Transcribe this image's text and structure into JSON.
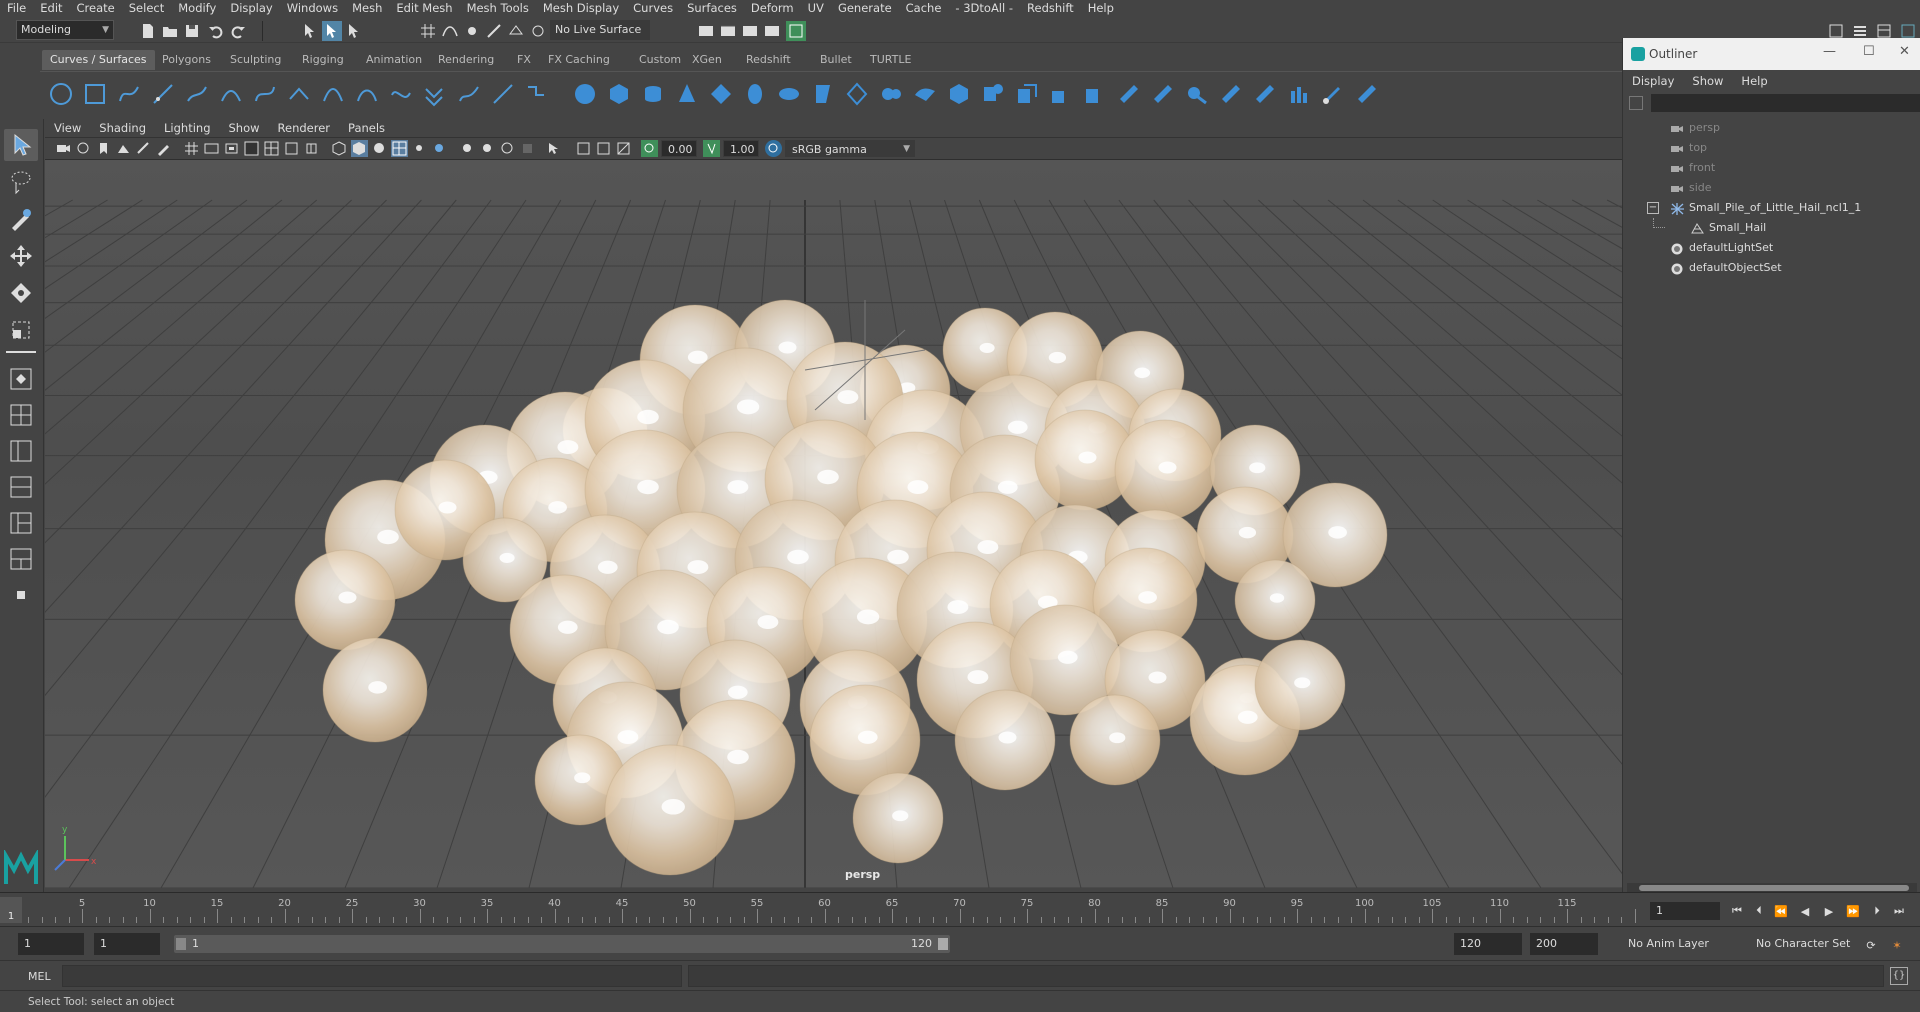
{
  "menubar": {
    "items": [
      "File",
      "Edit",
      "Create",
      "Select",
      "Modify",
      "Display",
      "Windows",
      "Mesh",
      "Edit Mesh",
      "Mesh Tools",
      "Mesh Display",
      "Curves",
      "Surfaces",
      "Deform",
      "UV",
      "Generate",
      "Cache",
      "- 3DtoAll -",
      "Redshift",
      "Help"
    ]
  },
  "statusline": {
    "mode": "Modeling",
    "live_surface": "No Live Surface"
  },
  "shelf": {
    "tabs": [
      "Curves / Surfaces",
      "Polygons",
      "Sculpting",
      "Rigging",
      "Animation",
      "Rendering",
      "FX",
      "FX Caching",
      "Custom",
      "XGen",
      "Redshift",
      "Bullet",
      "TURTLE"
    ],
    "active_tab": "Curves / Surfaces"
  },
  "panel": {
    "menu": [
      "View",
      "Shading",
      "Lighting",
      "Show",
      "Renderer",
      "Panels"
    ],
    "exposure": "0.00",
    "gamma": "1.00",
    "color_space": "sRGB gamma",
    "camera_label": "persp"
  },
  "outliner": {
    "title": "Outliner",
    "menu": [
      "Display",
      "Show",
      "Help"
    ],
    "items": [
      {
        "label": "persp",
        "icon": "camera-icon",
        "dim": true,
        "indent": 0
      },
      {
        "label": "top",
        "icon": "camera-icon",
        "dim": true,
        "indent": 0
      },
      {
        "label": "front",
        "icon": "camera-icon",
        "dim": true,
        "indent": 0
      },
      {
        "label": "side",
        "icon": "camera-icon",
        "dim": true,
        "indent": 0
      },
      {
        "label": "Small_Pile_of_Little_Hail_ncl1_1",
        "icon": "transform-icon",
        "dim": false,
        "indent": 0,
        "expanded": true
      },
      {
        "label": "Small_Hail",
        "icon": "mesh-icon",
        "dim": false,
        "indent": 1
      },
      {
        "label": "defaultLightSet",
        "icon": "set-icon",
        "dim": false,
        "indent": 0
      },
      {
        "label": "defaultObjectSet",
        "icon": "set-icon",
        "dim": false,
        "indent": 0
      }
    ]
  },
  "timeslider": {
    "current_frame": "1",
    "ticks": [
      "5",
      "10",
      "15",
      "20",
      "25",
      "30",
      "35",
      "40",
      "45",
      "50",
      "55",
      "60",
      "65",
      "70",
      "75",
      "80",
      "85",
      "90",
      "95",
      "100",
      "105",
      "110",
      "115"
    ],
    "frame_field": "1"
  },
  "range": {
    "start_a": "1",
    "start_b": "1",
    "slider_start": "1",
    "slider_end": "120",
    "end_a": "120",
    "end_b": "200",
    "anim_layer": "No Anim Layer",
    "character_set": "No Character Set"
  },
  "cmdline": {
    "label": "MEL"
  },
  "helpline": {
    "text": "Select Tool: select an object"
  },
  "colors": {
    "ui_bg": "#444444",
    "viewport_bg": "#525252",
    "accent_teal": "#19a1a1",
    "hail_light": "#f3ece4",
    "hail_warm": "#d9b892"
  }
}
